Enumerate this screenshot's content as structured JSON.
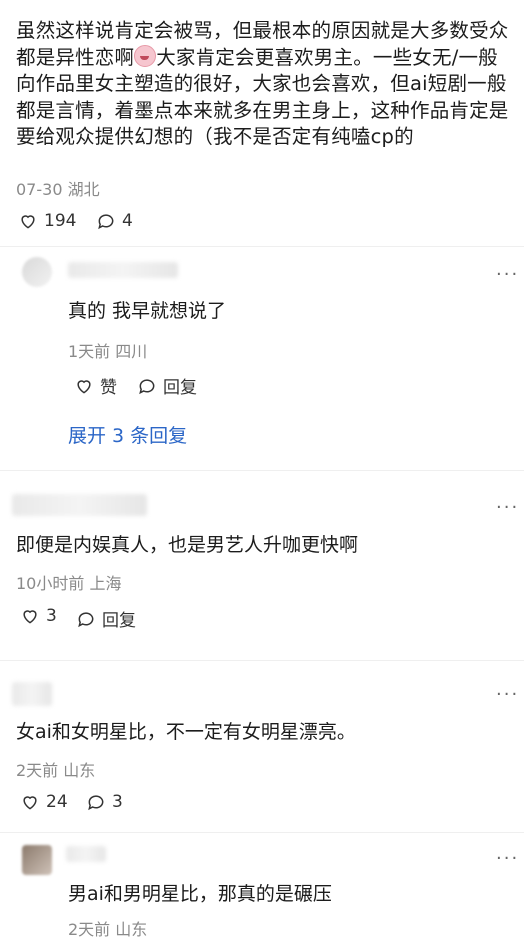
{
  "post": {
    "text": "虽然这样说肯定会被骂，但最根本的原因就是大多数受众都是异性恋啊",
    "text2": "大家肯定会更喜欢男主。一些女无/一般向作品里女主塑造的很好，大家也会喜欢，但ai短剧一般都是言情，着墨点本来就多在男主身上，这种作品肯定是要给观众提供幻想的（我不是否定有纯嗑cp的",
    "meta": "07-30 湖北",
    "likes": "194",
    "comments": "4"
  },
  "replies": [
    {
      "text": "真的 我早就想说了",
      "meta": "1天前 四川",
      "like_label": "赞",
      "reply_label": "回复",
      "expand": "展开 3 条回复"
    },
    {
      "text": "即便是内娱真人，也是男艺人升咖更快啊",
      "meta": "10小时前 上海",
      "likes": "3",
      "reply_label": "回复"
    },
    {
      "text": "女ai和女明星比，不一定有女明星漂亮。",
      "meta": "2天前 山东",
      "likes": "24",
      "comments": "3"
    },
    {
      "text": "男ai和男明星比，那真的是碾压",
      "meta": "2天前 山东"
    }
  ],
  "more_label": "···"
}
